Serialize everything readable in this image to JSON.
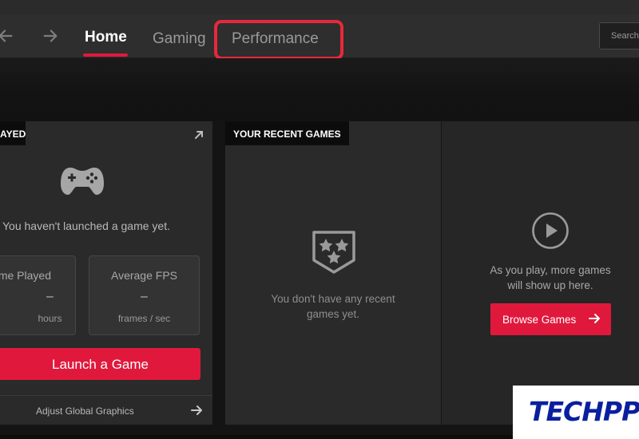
{
  "nav": {
    "back_icon": "arrow-left-icon",
    "forward_icon": "arrow-right-icon",
    "tabs": [
      {
        "label": "Home",
        "active": true
      },
      {
        "label": "Gaming",
        "active": false
      },
      {
        "label": "Performance",
        "active": false,
        "highlighted": true
      }
    ],
    "search_placeholder": "Search"
  },
  "played_panel": {
    "tag": "AYED",
    "expand_icon": "expand-arrow-icon",
    "icon": "game-controller-icon",
    "message": "You haven't launched a game yet.",
    "stats": [
      {
        "title": "me Played",
        "value": "–",
        "unit": "hours"
      },
      {
        "title": "Average FPS",
        "value": "–",
        "unit": "frames / sec"
      }
    ],
    "launch_label": "Launch a Game",
    "adjust_label": "Adjust Global Graphics",
    "adjust_icon": "arrow-right-icon"
  },
  "recent_panel": {
    "tag": "YOUR RECENT GAMES",
    "icon": "star-badge-icon",
    "message": "You don't have any recent\ngames yet."
  },
  "browse_panel": {
    "icon": "play-circle-icon",
    "message": "As you play, more games\nwill show up here.",
    "button_label": "Browse Games",
    "button_icon": "arrow-right-icon"
  },
  "watermark": {
    "text": "TECHPP"
  },
  "colors": {
    "accent": "#e0193c",
    "highlight_box": "#e8283a",
    "panel": "#2a2a2a",
    "background": "#141414",
    "watermark_text": "#0a1f9e"
  }
}
